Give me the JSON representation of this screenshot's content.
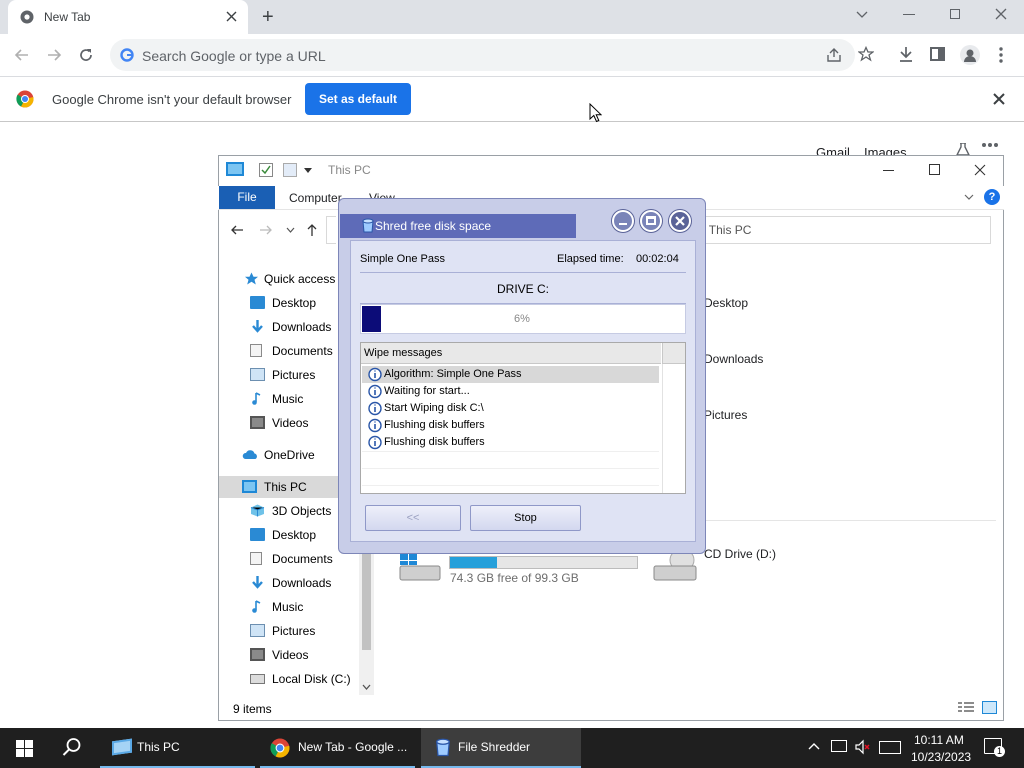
{
  "chrome": {
    "tab_title": "New Tab",
    "new_tab_label": "+",
    "omnibox_placeholder": "Search Google or type a URL",
    "infobar_text": "Google Chrome isn't your default browser",
    "set_default_label": "Set as default",
    "ntp_links": [
      "Gmail",
      "Images"
    ]
  },
  "explorer": {
    "title": "This PC",
    "ribbon_tabs": [
      "File",
      "Computer",
      "View"
    ],
    "search_placeholder": "rch This PC",
    "nav": {
      "quick_access": "Quick access",
      "qa_items": [
        "Desktop",
        "Downloads",
        "Documents",
        "Pictures",
        "Music",
        "Videos"
      ],
      "onedrive": "OneDrive",
      "this_pc": "This PC",
      "pc_items": [
        "3D Objects",
        "Desktop",
        "Documents",
        "Downloads",
        "Music",
        "Pictures",
        "Videos",
        "Local Disk (C:)"
      ]
    },
    "folders": [
      "Desktop",
      "Downloads",
      "Pictures"
    ],
    "drive_c": {
      "free_text": "74.3 GB free of 99.3 GB",
      "used_fraction": 0.25
    },
    "drive_d": "CD Drive (D:)",
    "status": "9 items"
  },
  "shredder": {
    "title": "Shred free disk space",
    "algorithm": "Simple One Pass",
    "elapsed_label": "Elapsed time:",
    "elapsed_value": "00:02:04",
    "drive_label": "DRIVE C:",
    "progress_text": "6%",
    "progress_fraction": 0.06,
    "messages_header": "Wipe messages",
    "messages": [
      "Algorithm: Simple One Pass",
      "Waiting for start...",
      "Start Wiping disk C:\\",
      "Flushing disk buffers",
      "Flushing disk buffers"
    ],
    "back_label": "<<",
    "stop_label": "Stop"
  },
  "taskbar": {
    "items": [
      "This PC",
      "New Tab - Google ...",
      "File Shredder"
    ],
    "time": "10:11 AM",
    "date": "10/23/2023",
    "notification_count": "1"
  },
  "colors": {
    "accent": "#1a73e8",
    "explorer_file_tab": "#1a5fb4",
    "shredder_title": "#5e6bb8",
    "progress": "#0c0c78",
    "taskbar": "#1f1f1f"
  }
}
